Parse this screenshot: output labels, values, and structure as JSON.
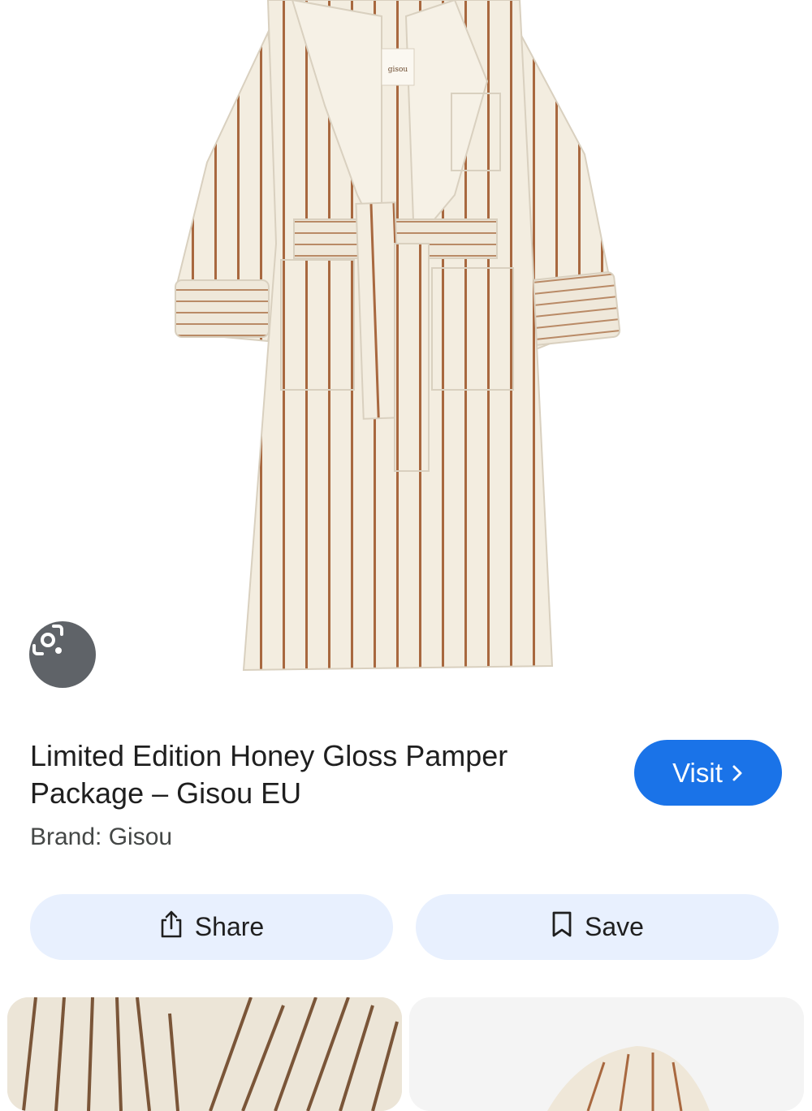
{
  "result": {
    "title": "Limited Edition Honey Gloss Pamper Package – Gisou EU",
    "brand": "Brand: Gisou"
  },
  "hero": {
    "image": "striped-bathrobe",
    "label_text": "gisou"
  },
  "actions": {
    "visit_label": "Visit",
    "share_label": "Share",
    "save_label": "Save"
  },
  "icons": {
    "lens": "google-lens-icon",
    "visit": "chevron-right-icon",
    "share": "share-icon",
    "save": "bookmark-icon"
  },
  "colors": {
    "visit_button": "#1a73e8",
    "action_button": "#e8f0fe",
    "lens_button": "#5f6368",
    "robe": "#f3ede0",
    "stripe": "#a8683f"
  }
}
